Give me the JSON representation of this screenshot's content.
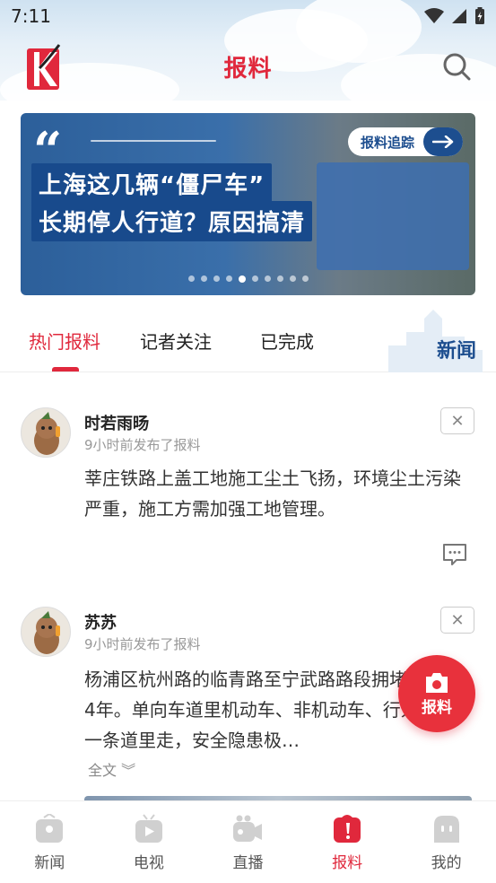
{
  "status_bar": {
    "time": "7:11"
  },
  "header": {
    "title": "报料"
  },
  "banner": {
    "headline_line1": "上海这几辆“僵尸车”",
    "headline_line2": "长期停人行道？原因搞清",
    "tag": "报料追踪",
    "dot_count": 10,
    "active_dot": 4
  },
  "tabs": [
    {
      "label": "热门报料"
    },
    {
      "label": "记者关注"
    },
    {
      "label": "已完成"
    }
  ],
  "brand_mark": "新闻",
  "posts": [
    {
      "author": "时若雨旸",
      "time": "9小时前发布了报料",
      "content": "莘庄铁路上盖工地施工尘土飞扬，环境尘土污染严重，施工方需加强工地管理。"
    },
    {
      "author": "苏苏",
      "time": "9小时前发布了报料",
      "content": "杨浦区杭州路的临青路至宁武路路段拥堵，长达4年。单向车道里机动车、非机动车、行人混在一条道里走，安全隐患极…",
      "full_text": "全文"
    }
  ],
  "fab": {
    "label": "报料"
  },
  "bottom_nav": [
    {
      "label": "新闻",
      "active": false
    },
    {
      "label": "电视",
      "active": false
    },
    {
      "label": "直播",
      "active": false
    },
    {
      "label": "报料",
      "active": true
    },
    {
      "label": "我的",
      "active": false
    }
  ],
  "colors": {
    "accent": "#e0283c",
    "banner_blue": "#184a8c"
  }
}
